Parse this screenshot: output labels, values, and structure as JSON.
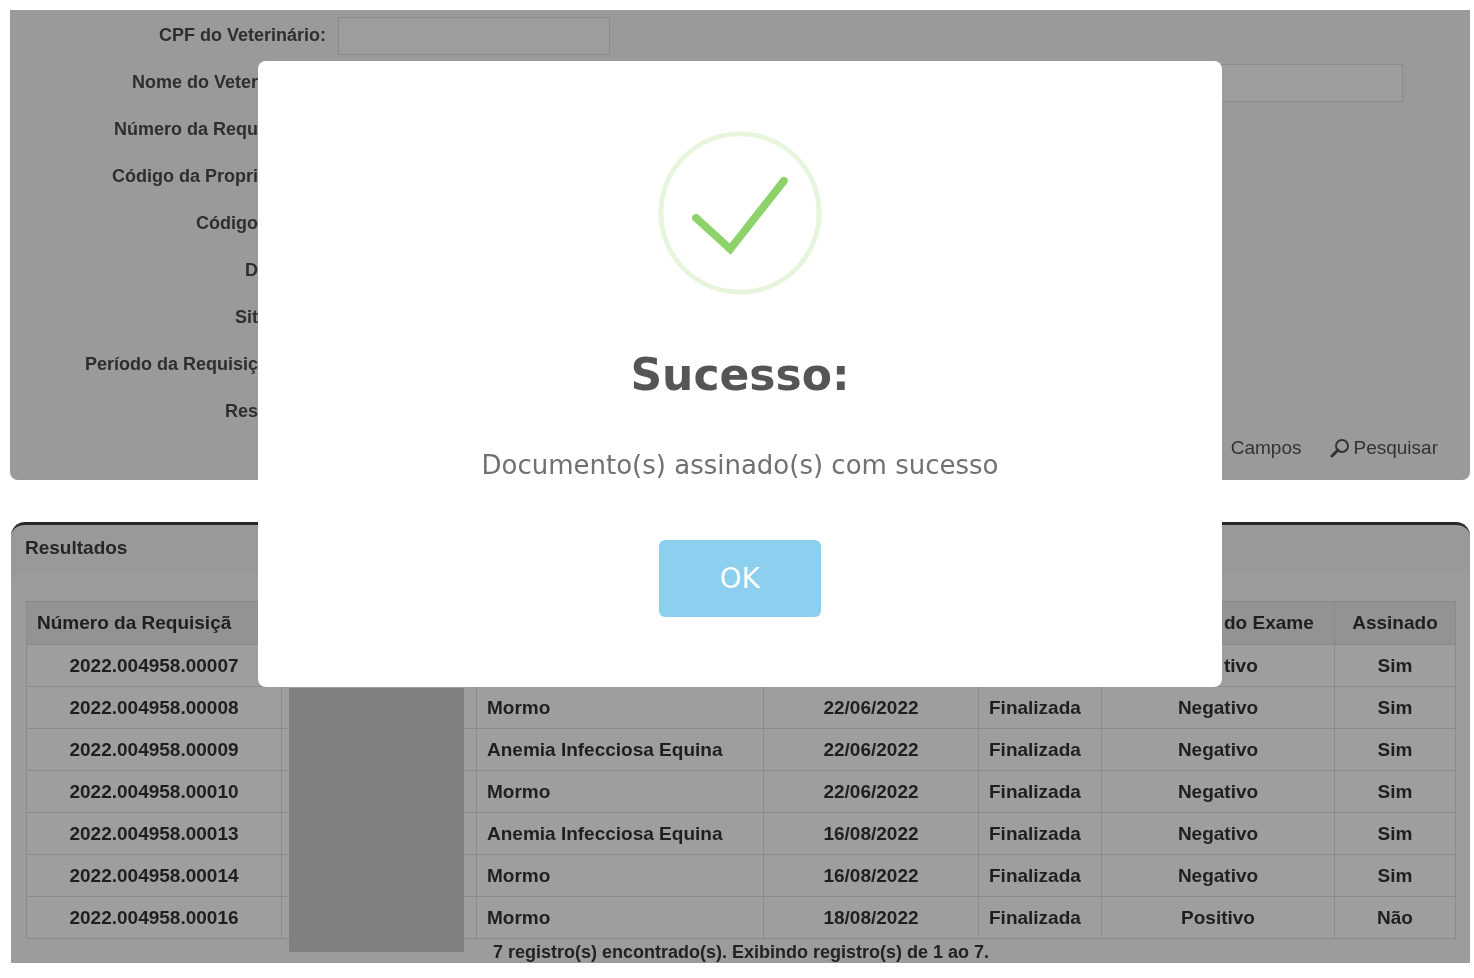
{
  "search_form": {
    "fields": [
      {
        "label": "CPF do Veterinário:",
        "kind": "field"
      },
      {
        "label": "Nome do Veter",
        "kind": "pair"
      },
      {
        "label": "Número da Requ",
        "kind": "covered"
      },
      {
        "label": "Código da Propri",
        "kind": "covered"
      },
      {
        "label": "Código",
        "kind": "covered"
      },
      {
        "label": "D",
        "kind": "covered"
      },
      {
        "label": "Sit",
        "kind": "covered"
      },
      {
        "label": "Período da Requisiç",
        "kind": "covered"
      },
      {
        "label": "Res",
        "kind": "covered"
      }
    ],
    "buttons": [
      {
        "label": "Campos",
        "kind": "plain"
      },
      {
        "label": "Pesquisar",
        "kind": "search"
      }
    ]
  },
  "results": {
    "title": "Resultados",
    "columns": {
      "column_1": "Número da Requisiçã",
      "column_6": "do Exame",
      "column_7": "Assinado"
    },
    "rows": [
      {
        "kind": "covered",
        "column_1": "2022.004958.00007",
        "column_6": "tivo",
        "column_7": "Sim"
      },
      {
        "kind": "full",
        "column_1": "2022.004958.00008",
        "column_3": "Mormo",
        "column_4": "22/06/2022",
        "column_5": "Finalizada",
        "column_6": "Negativo",
        "column_7": "Sim"
      },
      {
        "kind": "full",
        "column_1": "2022.004958.00009",
        "column_3": "Anemia Infecciosa Equina",
        "column_4": "22/06/2022",
        "column_5": "Finalizada",
        "column_6": "Negativo",
        "column_7": "Sim"
      },
      {
        "kind": "full",
        "column_1": "2022.004958.00010",
        "column_3": "Mormo",
        "column_4": "22/06/2022",
        "column_5": "Finalizada",
        "column_6": "Negativo",
        "column_7": "Sim"
      },
      {
        "kind": "full",
        "column_1": "2022.004958.00013",
        "column_3": "Anemia Infecciosa Equina",
        "column_4": "16/08/2022",
        "column_5": "Finalizada",
        "column_6": "Negativo",
        "column_7": "Sim"
      },
      {
        "kind": "full",
        "column_1": "2022.004958.00014",
        "column_3": "Mormo",
        "column_4": "16/08/2022",
        "column_5": "Finalizada",
        "column_6": "Negativo",
        "column_7": "Sim"
      },
      {
        "kind": "full",
        "column_1": "2022.004958.00016",
        "column_3": "Mormo",
        "column_4": "18/08/2022",
        "column_5": "Finalizada",
        "column_6": "Positivo",
        "column_7": "Não"
      }
    ],
    "footer": "7 registro(s) encontrado(s). Exibindo registro(s) de 1 ao 7."
  },
  "dialog": {
    "title": "Sucesso:",
    "message": "Documento(s) assinado(s) com sucesso",
    "button": "OK"
  }
}
